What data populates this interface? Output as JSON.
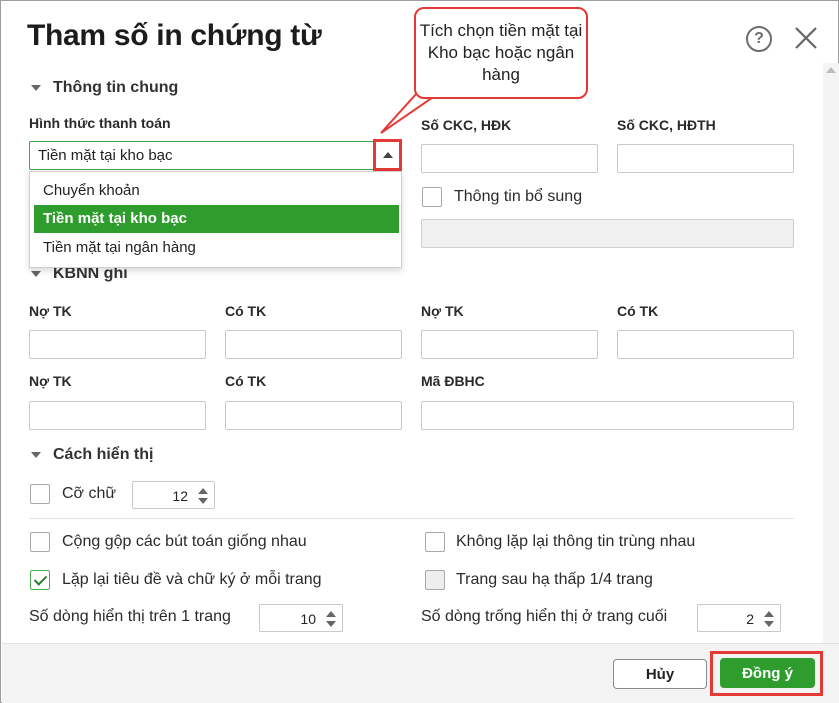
{
  "dialog": {
    "title": "Tham số in chứng từ",
    "help_symbol": "?",
    "callout": "Tích chọn tiền mặt tại Kho bạc hoặc ngân hàng"
  },
  "general": {
    "heading": "Thông tin chung",
    "payment_label": "Hình thức thanh toán",
    "payment_value": "Tiền mặt tại kho bạc",
    "payment_options": [
      "Chuyển khoản",
      "Tiền mặt tại kho bạc",
      "Tiền mặt tại ngân hàng"
    ],
    "payment_selected_index": 1,
    "ckc_hdk_label": "Số CKC, HĐK",
    "ckc_hdth_label": "Số CKC, HĐTH",
    "extra_info_label": "Thông tin bổ sung"
  },
  "kbnn": {
    "heading": "KBNN ghi",
    "no_tk_1": "Nợ TK",
    "co_tk_1": "Có TK",
    "no_tk_2": "Nợ TK",
    "co_tk_2": "Có TK",
    "no_tk_3": "Nợ TK",
    "co_tk_3": "Có TK",
    "ma_dbhc": "Mã ĐBHC"
  },
  "display": {
    "heading": "Cách hiển thị",
    "font_size_label": "Cỡ chữ",
    "font_size_value": "12",
    "merge_entries": "Cộng gộp các bút toán giống nhau",
    "no_repeat_info": "Không lặp lại thông tin trùng nhau",
    "repeat_header": "Lặp lại tiêu đề và chữ ký ở mỗi trang",
    "lower_next_page": "Trang sau hạ thấp 1/4 trang",
    "rows_per_page_label": "Số dòng hiển thị trên 1 trang",
    "rows_per_page_value": "10",
    "empty_rows_label": "Số dòng trống hiển thị ở trang cuối",
    "empty_rows_value": "2"
  },
  "buttons": {
    "cancel": "Hủy",
    "ok": "Đồng ý"
  },
  "colors": {
    "accent_green": "#2e9d2e",
    "highlight_red": "#e53935"
  }
}
